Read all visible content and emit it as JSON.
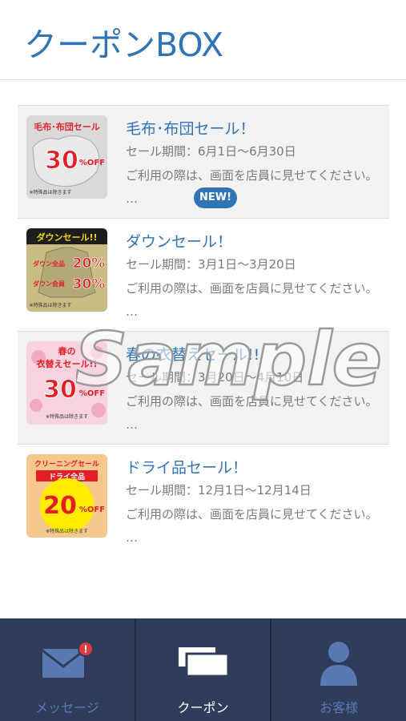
{
  "header": {
    "title": "クーポンBOX"
  },
  "coupons": [
    {
      "title": "毛布･布団セール！",
      "period": "セール期間：6月1日～6月30日",
      "desc": "ご利用の際は、画面を店員に見せてください。",
      "more": "…",
      "badge": "NEW!",
      "image": {
        "heading": "毛布･布団セール",
        "discount": "30",
        "unit": "%OFF",
        "note": "※特殊品は除きます"
      }
    },
    {
      "title": "ダウンセール！",
      "period": "セール期間：3月1日～3月20日",
      "desc": "ご利用の際は、画面を店員に見せてください。",
      "more": "…",
      "image": {
        "heading": "ダウンセール!!",
        "line1": "ダウン全品",
        "pct1": "20%",
        "line2": "ダウン会員",
        "pct2": "30%",
        "note": "※特殊品は除きます"
      }
    },
    {
      "title": "春の衣替えセール!!",
      "period": "セール期間：3月20日～4月10日",
      "desc": "ご利用の際は、画面を店員に見せてください。",
      "more": "…",
      "image": {
        "heading1": "春の",
        "heading2": "衣替えセール!!",
        "discount": "30",
        "unit": "%OFF",
        "note": "※特殊品は除きます"
      }
    },
    {
      "title": "ドライ品セール！",
      "period": "セール期間：12月1日～12月14日",
      "desc": "ご利用の際は、画面を店員に見せてください。",
      "more": "…",
      "image": {
        "heading": "クリーニングセール",
        "ribbon": "ドライ全品",
        "discount": "20",
        "unit": "%OFF",
        "note": "※特殊品は除きます"
      }
    }
  ],
  "watermark": "Sample",
  "tabs": [
    {
      "label": "メッセージ",
      "icon": "envelope-icon",
      "active": false,
      "notification": "!"
    },
    {
      "label": "クーポン",
      "icon": "coupon-icon",
      "active": true
    },
    {
      "label": "お客様",
      "icon": "person-icon",
      "active": false
    }
  ],
  "colors": {
    "accent": "#2f75b5",
    "tabbar": "#2f3d5b",
    "inactive_tab": "#5979b3",
    "badge_red": "#e0393e"
  }
}
